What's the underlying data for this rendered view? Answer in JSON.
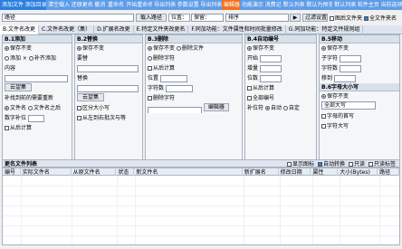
{
  "toolbar": {
    "items": [
      "添加文件",
      "添加目录",
      "清空载入",
      "还原更名",
      "撤消",
      "重命名",
      "开始重命名",
      "导出列表",
      "参数设置",
      "导出列表",
      "编辑器",
      "功能演示",
      "消费记",
      "默认列表",
      "默认为预览",
      "默认列表",
      "软件主页",
      "当前选项"
    ]
  },
  "top": {
    "format_label": "路径",
    "format_value": "",
    "preset_label": "载入路径",
    "pos_label": "位置：",
    "pos_value": "保留：",
    "sort_label": "排序",
    "filter_label": "过滤设置",
    "check1": "图后文件夹",
    "check2": "全文件夹名"
  },
  "tabs": [
    "B.文件名改更",
    "C.文件名改更（集）",
    "D.扩展名改更",
    "E.特定文件夹改更名",
    "F.同加功能：文件属性和时间批量修改",
    "G.同加功能：特定文件规则组"
  ],
  "p1": {
    "title": "B.1添加",
    "r1": "保存不变",
    "r2": "添加 ×",
    "r3": "补齐添加",
    "l_content": "内容",
    "btn": "云望集",
    "l_place": "补找到前的需要重新",
    "c1": "文件名",
    "c2": "文件名之后",
    "l_fill": "数字补位",
    "num": "0",
    "c3": "从后计算"
  },
  "p2": {
    "title": "B.2替换",
    "r1": "保存不变",
    "l_find": "要替",
    "l_rep": "替换",
    "btn": "云望集",
    "c1": "区分大小写",
    "c2": "从左到右批次与等"
  },
  "p3": {
    "title": "B.3删除",
    "r1": "保存不变",
    "r2": "删除文件",
    "r3": "删除字符",
    "c1": "从后计算",
    "l_pos": "位置",
    "l_count": "字符数",
    "c2": "删除字符",
    "btn": "编辑器"
  },
  "p4": {
    "title": "B.4自动编号",
    "r1": "保存不变",
    "l_start": "开始",
    "l_step": "增量",
    "l_digits": "位数",
    "c1": "从后计算",
    "c2": "全部编号",
    "l_pre": "补位符",
    "r2": "自动",
    "r3": "自定"
  },
  "p5": {
    "title": "B.5移动",
    "r1": "保存不变",
    "l_from": "子字符",
    "l_len": "字符数",
    "l_to": "移到",
    "c1": "从后计算",
    "title2": "B.6字母大小写",
    "r2": "保存不变",
    "sel": "全部大写",
    "l_sent": "字母的首写",
    "l_extra": "字符大写"
  },
  "list": {
    "title": "更名文件列表",
    "columns": [
      "编号",
      "实际文件名",
      "从原文件名",
      "状态",
      "新文件名",
      "新扩展名",
      "修改日期",
      "属性",
      "大小(Bytes)",
      "路径"
    ],
    "right_checks": [
      "显示图标",
      "自动转换",
      "只读",
      "只读标签"
    ]
  }
}
